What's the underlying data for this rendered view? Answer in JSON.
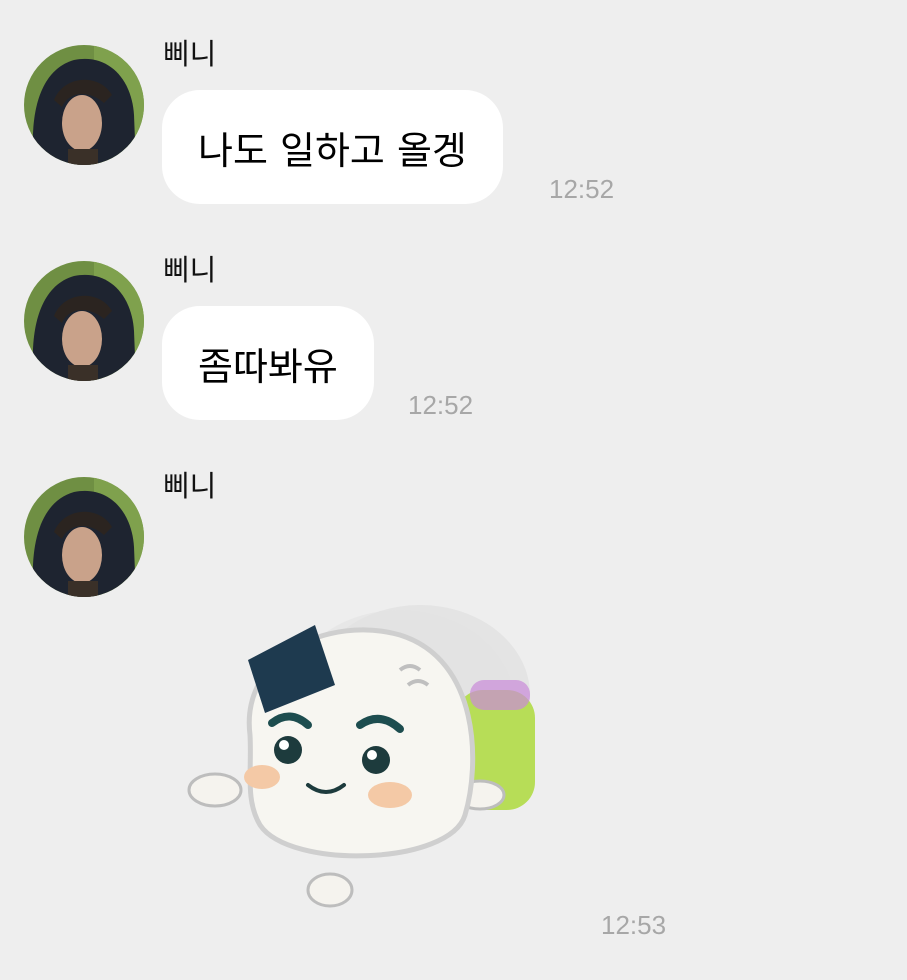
{
  "messages": [
    {
      "sender": "삐니",
      "text": "나도 일하고 올겡",
      "time": "12:52"
    },
    {
      "sender": "삐니",
      "text": "좀따봐유",
      "time": "12:52"
    },
    {
      "sender": "삐니",
      "sticker": "onigiri-character-waving-sticker",
      "time": "12:53"
    }
  ],
  "colors": {
    "background": "#eeeeee",
    "bubble": "#ffffff",
    "timestamp": "#a7a7a7"
  }
}
